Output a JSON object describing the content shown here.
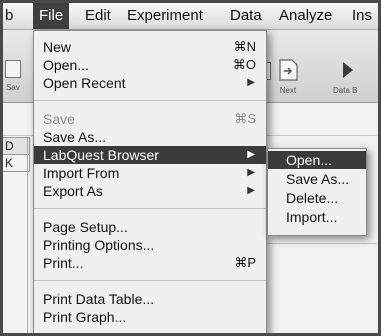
{
  "menubar": {
    "items": [
      "b",
      "File",
      "Edit",
      "Experiment",
      "Data",
      "Analyze",
      "Ins"
    ]
  },
  "toolbar": {
    "left_stub": "Sav",
    "next_label": "Next",
    "data_label": "Data B"
  },
  "table": {
    "header_left": "D",
    "row_left": "K"
  },
  "file_menu": {
    "groups": [
      [
        {
          "label": "New",
          "shortcut": "⌘N",
          "disabled": false
        },
        {
          "label": "Open...",
          "shortcut": "⌘O",
          "disabled": false
        },
        {
          "label": "Open Recent",
          "submenu": true,
          "disabled": false
        }
      ],
      [
        {
          "label": "Save",
          "shortcut": "⌘S",
          "disabled": true
        },
        {
          "label": "Save As...",
          "disabled": false
        },
        {
          "label": "LabQuest Browser",
          "submenu": true,
          "highlighted": true
        },
        {
          "label": "Import From",
          "submenu": true
        },
        {
          "label": "Export As",
          "submenu": true
        }
      ],
      [
        {
          "label": "Page Setup..."
        },
        {
          "label": "Printing Options..."
        },
        {
          "label": "Print...",
          "shortcut": "⌘P"
        }
      ],
      [
        {
          "label": "Print Data Table..."
        },
        {
          "label": "Print Graph..."
        }
      ]
    ],
    "submenu_arrow": "▶"
  },
  "labquest_submenu": {
    "items": [
      "Open...",
      "Save As...",
      "Delete...",
      "Import..."
    ]
  }
}
